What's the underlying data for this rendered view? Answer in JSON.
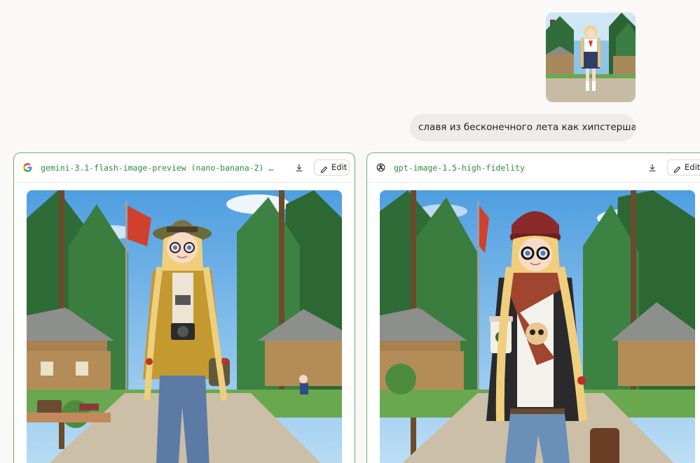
{
  "user_message": {
    "text": "славя из бесконечного лета как хипстерша"
  },
  "results": [
    {
      "provider_icon": "google-g-icon",
      "model": "gemini-3.1-flash-image-preview (nano-banana-2) …",
      "edit_label": "Edit"
    },
    {
      "provider_icon": "openai-icon",
      "model": "gpt-image-1.5-high-fidelity",
      "edit_label": "Edit"
    }
  ],
  "colors": {
    "card_border": "#6fb36a",
    "model_text": "#2e8b3a",
    "bubble_bg": "#efece8",
    "page_bg": "#faf9f7"
  }
}
